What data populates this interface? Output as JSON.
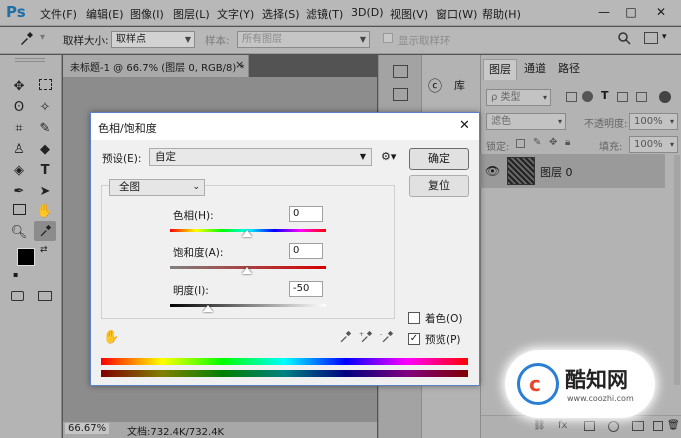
{
  "app": {
    "logo": "Ps"
  },
  "menu": {
    "items": [
      "文件(F)",
      "编辑(E)",
      "图像(I)",
      "图层(L)",
      "文字(Y)",
      "选择(S)",
      "滤镜(T)",
      "3D(D)",
      "视图(V)",
      "窗口(W)",
      "帮助(H)"
    ],
    "window_controls": {
      "minimize": "—",
      "maximize": "□",
      "close": "✕"
    }
  },
  "options_bar": {
    "sample_size_label": "取样大小:",
    "sample_size_value": "取样点",
    "sample_label": "样本:",
    "sample_value": "所有图层",
    "show_ring_label": "显示取样环"
  },
  "document": {
    "tab_title": "未标题-1 @ 66.7% (图层 0, RGB/8) *",
    "tab_close": "×",
    "zoom": "66.67%",
    "doc_info": "文档:732.4K/732.4K"
  },
  "library": {
    "label": "库"
  },
  "layers_panel": {
    "tabs": [
      "图层",
      "通道",
      "路径"
    ],
    "filter_kind": "类型",
    "blend_mode": "滤色",
    "opacity_label": "不透明度:",
    "opacity_value": "100%",
    "lock_label": "锁定:",
    "fill_label": "填充:",
    "fill_value": "100%",
    "layer_name": "图层 0"
  },
  "dialog": {
    "title": "色相/饱和度",
    "close": "✕",
    "preset_label": "预设(E):",
    "preset_value": "自定",
    "ok": "确定",
    "reset": "复位",
    "channel": "全图",
    "hue_label": "色相(H):",
    "hue_value": "0",
    "saturation_label": "饱和度(A):",
    "saturation_value": "0",
    "lightness_label": "明度(I):",
    "lightness_value": "-50",
    "colorize_label": "着色(O)",
    "preview_label": "预览(P)",
    "preview_checked": "✓"
  },
  "watermark": {
    "brand": "酷知网",
    "url": "www.coozhi.com"
  },
  "colors": {
    "accent": "#5a82c8",
    "logo": "#1e6fa8",
    "watermark_red": "#e8472e",
    "watermark_blue": "#2a7fd4"
  },
  "icons": [
    "eyedropper-icon",
    "search-icon",
    "panel-toggle-icon",
    "gear-icon",
    "hand-icon",
    "eye-icon",
    "lock-icon",
    "trash-icon"
  ]
}
